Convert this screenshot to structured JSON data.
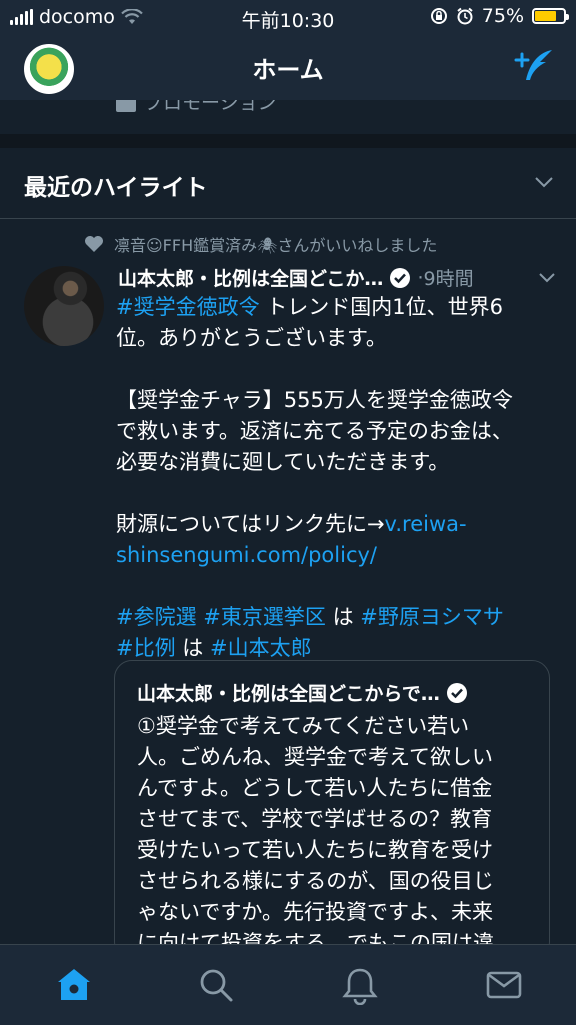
{
  "status": {
    "carrier": "docomo",
    "time": "午前10:30",
    "battery": "75%"
  },
  "nav": {
    "title": "ホーム"
  },
  "promo": {
    "label": "プロモーション"
  },
  "section": {
    "title": "最近のハイライト"
  },
  "social_context": {
    "text": "凛音☺FFH鑑賞済み🕷さんがいいねしました"
  },
  "tweet": {
    "author": "山本太郎・比例は全国どこか…",
    "dot": "·",
    "time": "9時間",
    "line1_hashtag": "#奨学金徳政令",
    "line1_rest": " トレンド国内1位、世界6",
    "line2": "位。ありがとうございます。",
    "para2_l1": "【奨学金チャラ】555万人を奨学金徳政令",
    "para2_l2": "で救います。返済に充てる予定のお金は、",
    "para2_l3": "必要な消費に廻していただきます。",
    "para3_text": "財源についてはリンク先に→",
    "link_l1": "v.reiwa-",
    "link_l2": "shinsengumi.com/policy/",
    "tags": {
      "t1": "#参院選",
      "t2": "#東京選挙区",
      "ha1": " は ",
      "t3": "#野原ヨシマサ",
      "t4": "#比例",
      "ha2": " は ",
      "t5": "#山本太郎"
    }
  },
  "quote": {
    "author": "山本太郎・比例は全国どこからで…",
    "lines": [
      "①奨学金で考えてみてください若い",
      "人。ごめんね、奨学金で考えて欲しい",
      "んですよ。どうして若い人たちに借金",
      "させてまで、学校で学ばせるの？教育",
      "受けたいって若い人たちに教育を受け",
      "させられる様にするのが、国の役目じ",
      "ゃないですか。先行投資ですよ、未来",
      "に向けて投資をする。でもこの国は違"
    ]
  },
  "colors": {
    "background": "#15202b",
    "bar": "#1c2938",
    "accent": "#1da1f2",
    "muted": "#8899a6",
    "battery": "#ffcc00"
  },
  "icons": [
    "signal-icon",
    "wifi-icon",
    "rotation-lock-icon",
    "alarm-icon",
    "battery-icon",
    "compose-tweet-icon",
    "chevron-down-icon",
    "heart-icon",
    "verified-icon",
    "home-icon",
    "search-icon",
    "bell-icon",
    "mail-icon"
  ]
}
